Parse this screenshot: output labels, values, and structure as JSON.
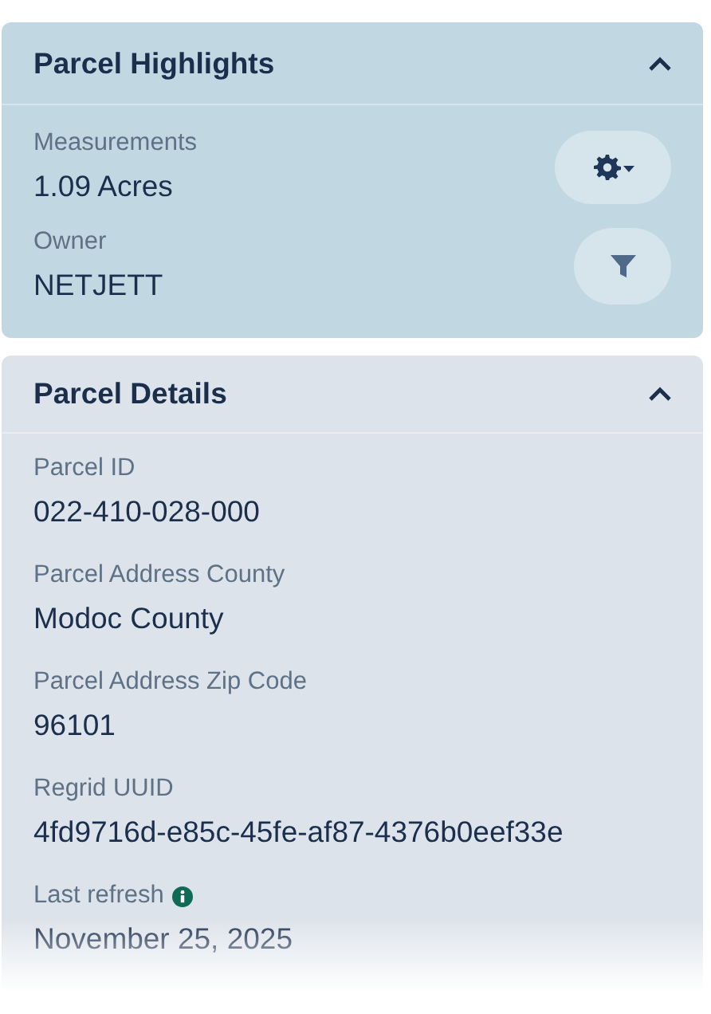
{
  "sections": [
    {
      "kind": "highlights",
      "title": "Parcel Highlights",
      "expanded": true,
      "fields": [
        {
          "label": "Measurements",
          "value": "1.09 Acres",
          "kind": "settings-menu"
        },
        {
          "label": "Owner",
          "value": "NETJETT",
          "kind": "filter"
        }
      ]
    },
    {
      "kind": "details",
      "title": "Parcel Details",
      "expanded": true,
      "fields": [
        {
          "label": "Parcel ID",
          "value": "022-410-028-000"
        },
        {
          "label": "Parcel Address County",
          "value": "Modoc County"
        },
        {
          "label": "Parcel Address Zip Code",
          "value": "96101"
        },
        {
          "label": "Regrid UUID",
          "value": "4fd9716d-e85c-45fe-af87-4376b0eef33e"
        },
        {
          "label": "Last refresh",
          "info": true,
          "value": "November 25, 2025"
        }
      ]
    }
  ]
}
